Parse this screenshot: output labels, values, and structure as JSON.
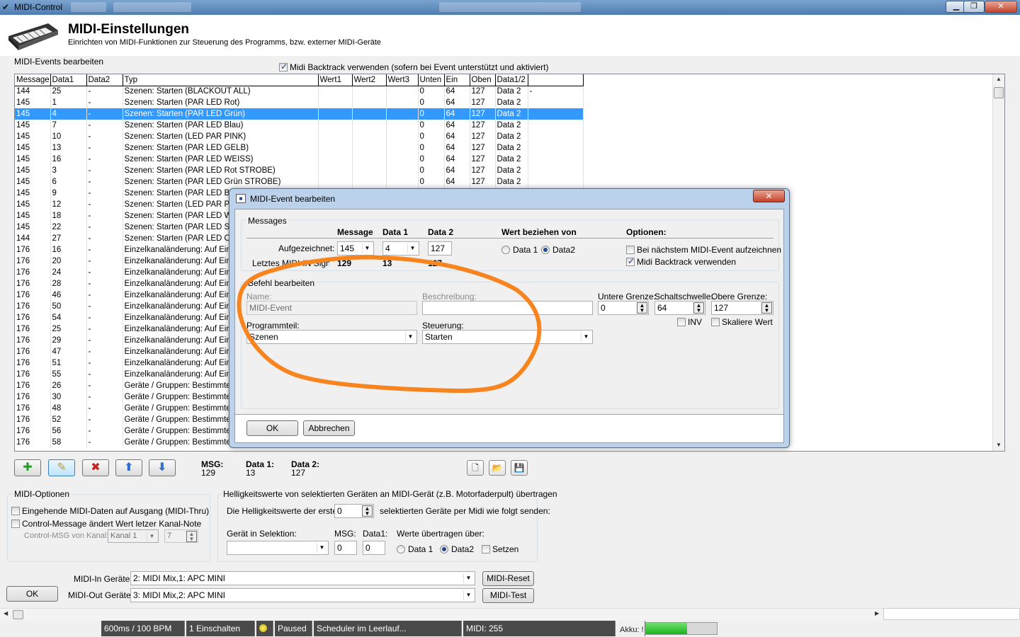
{
  "window": {
    "title": "MIDI-Control",
    "min": "▁",
    "max": "❐",
    "close": "✕"
  },
  "header": {
    "title": "MIDI-Einstellungen",
    "subtitle": "Einrichten von MIDI-Funktionen zur Steuerung des Programms, bzw. externer MIDI-Geräte"
  },
  "events": {
    "label": "MIDI-Events bearbeiten",
    "backtrack_label": "Midi Backtrack verwenden (sofern bei Event unterstützt und aktiviert)",
    "backtrack_checked": true
  },
  "table": {
    "columns": [
      "Message",
      "Data1",
      "Data2",
      "Typ",
      "Wert1",
      "Wert2",
      "Wert3",
      "Unten",
      "Ein",
      "Oben",
      "Data1/2",
      ""
    ],
    "rows": [
      [
        "144",
        "25",
        "-",
        "Szenen: Starten (BLACKOUT ALL)",
        "",
        "",
        "",
        "0",
        "64",
        "127",
        "Data 2",
        "-"
      ],
      [
        "145",
        "1",
        "-",
        "Szenen: Starten (PAR LED Rot)",
        "",
        "",
        "",
        "0",
        "64",
        "127",
        "Data 2",
        ""
      ],
      [
        "145",
        "4",
        "-",
        "Szenen: Starten (PAR LED Grün)",
        "",
        "",
        "",
        "0",
        "64",
        "127",
        "Data 2",
        ""
      ],
      [
        "145",
        "7",
        "-",
        "Szenen: Starten (PAR LED Blau)",
        "",
        "",
        "",
        "0",
        "64",
        "127",
        "Data 2",
        ""
      ],
      [
        "145",
        "10",
        "-",
        "Szenen: Starten (LED PAR PINK)",
        "",
        "",
        "",
        "0",
        "64",
        "127",
        "Data 2",
        ""
      ],
      [
        "145",
        "13",
        "-",
        "Szenen: Starten (PAR LED GELB)",
        "",
        "",
        "",
        "0",
        "64",
        "127",
        "Data 2",
        ""
      ],
      [
        "145",
        "16",
        "-",
        "Szenen: Starten (PAR LED WEISS)",
        "",
        "",
        "",
        "0",
        "64",
        "127",
        "Data 2",
        ""
      ],
      [
        "145",
        "3",
        "-",
        "Szenen: Starten (PAR LED Rot STROBE)",
        "",
        "",
        "",
        "0",
        "64",
        "127",
        "Data 2",
        ""
      ],
      [
        "145",
        "6",
        "-",
        "Szenen: Starten (PAR LED Grün STROBE)",
        "",
        "",
        "",
        "0",
        "64",
        "127",
        "Data 2",
        ""
      ],
      [
        "145",
        "9",
        "-",
        "Szenen: Starten (PAR LED Bla",
        "",
        "",
        "",
        "",
        "",
        "",
        "",
        ""
      ],
      [
        "145",
        "12",
        "-",
        "Szenen: Starten (LED PAR PIN",
        "",
        "",
        "",
        "",
        "",
        "",
        "",
        ""
      ],
      [
        "145",
        "18",
        "-",
        "Szenen: Starten (PAR LED WE",
        "",
        "",
        "",
        "",
        "",
        "",
        "",
        ""
      ],
      [
        "145",
        "22",
        "-",
        "Szenen: Starten (PAR LED ST",
        "",
        "",
        "",
        "",
        "",
        "",
        "",
        ""
      ],
      [
        "144",
        "27",
        "-",
        "Szenen: Starten (PAR LED OU",
        "",
        "",
        "",
        "",
        "",
        "",
        "",
        ""
      ],
      [
        "176",
        "16",
        "-",
        "Einzelkanaländerung: Auf Eing",
        "",
        "",
        "",
        "",
        "",
        "",
        "",
        ""
      ],
      [
        "176",
        "20",
        "-",
        "Einzelkanaländerung: Auf Eing",
        "",
        "",
        "",
        "",
        "",
        "",
        "",
        ""
      ],
      [
        "176",
        "24",
        "-",
        "Einzelkanaländerung: Auf Eing",
        "",
        "",
        "",
        "",
        "",
        "",
        "",
        ""
      ],
      [
        "176",
        "28",
        "-",
        "Einzelkanaländerung: Auf Eing",
        "",
        "",
        "",
        "",
        "",
        "",
        "",
        ""
      ],
      [
        "176",
        "46",
        "-",
        "Einzelkanaländerung: Auf Eing",
        "",
        "",
        "",
        "",
        "",
        "",
        "",
        ""
      ],
      [
        "176",
        "50",
        "-",
        "Einzelkanaländerung: Auf Eing",
        "",
        "",
        "",
        "",
        "",
        "",
        "",
        ""
      ],
      [
        "176",
        "54",
        "-",
        "Einzelkanaländerung: Auf Eing",
        "",
        "",
        "",
        "",
        "",
        "",
        "",
        ""
      ],
      [
        "176",
        "25",
        "-",
        "Einzelkanaländerung: Auf Eing",
        "",
        "",
        "",
        "",
        "",
        "",
        "",
        ""
      ],
      [
        "176",
        "29",
        "-",
        "Einzelkanaländerung: Auf Eing",
        "",
        "",
        "",
        "",
        "",
        "",
        "",
        ""
      ],
      [
        "176",
        "47",
        "-",
        "Einzelkanaländerung: Auf Eing",
        "",
        "",
        "",
        "",
        "",
        "",
        "",
        ""
      ],
      [
        "176",
        "51",
        "-",
        "Einzelkanaländerung: Auf Eing",
        "",
        "",
        "",
        "",
        "",
        "",
        "",
        ""
      ],
      [
        "176",
        "55",
        "-",
        "Einzelkanaländerung: Auf Eing",
        "",
        "",
        "",
        "",
        "",
        "",
        "",
        ""
      ],
      [
        "176",
        "26",
        "-",
        "Geräte / Gruppen: Bestimmte G",
        "",
        "",
        "",
        "",
        "",
        "",
        "",
        ""
      ],
      [
        "176",
        "30",
        "-",
        "Geräte / Gruppen: Bestimmte G",
        "",
        "",
        "",
        "",
        "",
        "",
        "",
        ""
      ],
      [
        "176",
        "48",
        "-",
        "Geräte / Gruppen: Bestimmte G",
        "",
        "",
        "",
        "",
        "",
        "",
        "",
        ""
      ],
      [
        "176",
        "52",
        "-",
        "Geräte / Gruppen: Bestimmte G",
        "",
        "",
        "",
        "",
        "",
        "",
        "",
        ""
      ],
      [
        "176",
        "56",
        "-",
        "Geräte / Gruppen: Bestimmte G",
        "",
        "",
        "",
        "",
        "",
        "",
        "",
        ""
      ],
      [
        "176",
        "58",
        "-",
        "Geräte / Gruppen: Bestimmte G",
        "",
        "",
        "",
        "",
        "",
        "",
        "",
        ""
      ]
    ],
    "selected_row": 2
  },
  "toolbar": {
    "msg_label": "MSG:",
    "msg_value": "129",
    "data1_label": "Data 1:",
    "data1_value": "13",
    "data2_label": "Data 2:",
    "data2_value": "127"
  },
  "options": {
    "label": "MIDI-Optionen",
    "thru": "Eingehende MIDI-Daten auf Ausgang (MIDI-Thru)",
    "control": "Control-Message ändert Wert letzer Kanal-Note",
    "channel_label": "Control-MSG von Kanal:",
    "channel_value": "Kanal 1",
    "channel_num": "7"
  },
  "brightness": {
    "label": "Helligkeitswerte von selektierten Geräten an MIDI-Gerät (z.B. Motorfaderpult) übertragen",
    "first_label": "Die Helligkeitswerte der ersten",
    "first_value": "0",
    "send_label": "selektierten Geräte per Midi wie folgt senden:",
    "device_label": "Gerät in Selektion:",
    "msg_label": "MSG:",
    "msg_value": "0",
    "data1_label": "Data1:",
    "data1_value": "0",
    "transfer_label": "Werte übertragen über:",
    "r_data1": "Data 1",
    "r_data2": "Data2",
    "set_label": "Setzen"
  },
  "devices": {
    "in_label": "MIDI-In Geräte:",
    "in_value": "2: MIDI Mix,1: APC MINI",
    "out_label": "MIDI-Out Geräte:",
    "out_value": "3: MIDI Mix,2: APC MINI",
    "reset": "MIDI-Reset",
    "test": "MIDI-Test",
    "ok": "OK"
  },
  "status": {
    "bpm": "600ms / 100 BPM",
    "on": "1 Einschalten",
    "paused": "Paused",
    "scheduler": "Scheduler im Leerlauf...",
    "midi": "MIDI: 255",
    "akku": "Akku: !",
    "akku_level": 0.58
  },
  "dialog": {
    "title": "MIDI-Event bearbeiten",
    "close": "✕",
    "messages_label": "Messages",
    "col_message": "Message",
    "col_data1": "Data 1",
    "col_data2": "Data 2",
    "wert_label": "Wert beziehen von",
    "opt_label": "Optionen:",
    "recorded_label": "Aufgezeichnet:",
    "rec_msg": "145",
    "rec_d1": "4",
    "rec_d2": "127",
    "last_label": "Letztes MIDI-IN Signal:",
    "last_msg": "129",
    "last_d1": "13",
    "last_d2": "127",
    "r_data1": "Data 1",
    "r_data2": "Data2",
    "opt_next": "Bei nächstem MIDI-Event aufzeichnen",
    "opt_backtrack": "Midi Backtrack verwenden",
    "befehl_label": "Befehl bearbeiten",
    "name_label": "Name:",
    "name_value": "MIDI-Event",
    "desc_label": "Beschreibung:",
    "desc_value": "",
    "lower_label": "Untere Grenze:",
    "lower_value": "0",
    "thresh_label": "Schaltschwelle:",
    "thresh_value": "64",
    "upper_label": "Obere Grenze:",
    "upper_value": "127",
    "inv_label": "INV",
    "scale_label": "Skaliere Wert",
    "prog_label": "Programmteil:",
    "prog_value": "Szenen",
    "ctrl_label": "Steuerung:",
    "ctrl_value": "Starten",
    "ok": "OK",
    "cancel": "Abbrechen"
  },
  "colors": {
    "accent": "#3399ff",
    "annotation": "#f7841f"
  }
}
